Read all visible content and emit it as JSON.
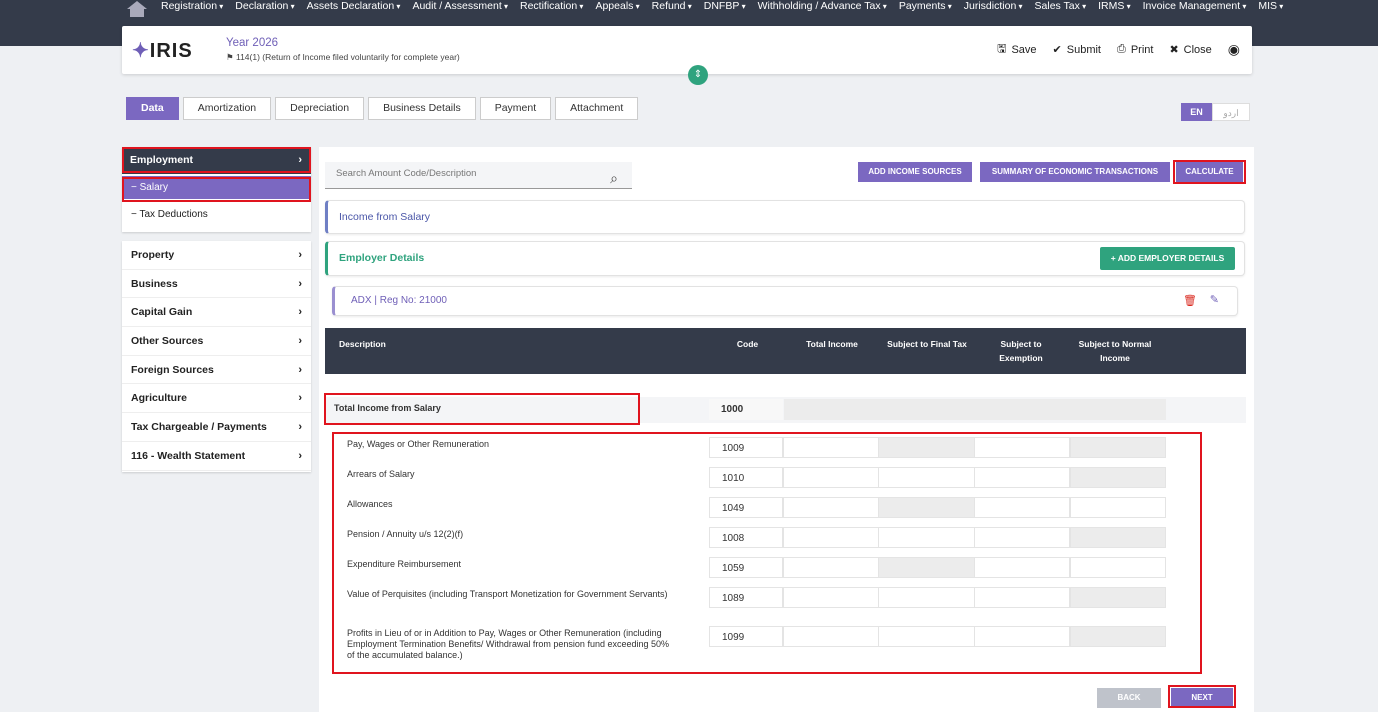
{
  "nav": {
    "items": [
      "Registration",
      "Declaration",
      "Assets Declaration",
      "Audit / Assessment",
      "Rectification",
      "Appeals",
      "Refund",
      "DNFBP",
      "Withholding / Advance Tax",
      "Payments",
      "Jurisdiction",
      "Sales Tax",
      "IRMS",
      "Invoice Management",
      "MIS"
    ]
  },
  "header": {
    "logo": "IRIS",
    "year": "Year 2026",
    "subtitle": "114(1) (Return of Income filed voluntarily for complete year)",
    "save": "Save",
    "submit": "Submit",
    "print": "Print",
    "close": "Close"
  },
  "tabs": [
    "Data",
    "Amortization",
    "Depreciation",
    "Business Details",
    "Payment",
    "Attachment"
  ],
  "lang": {
    "en": "EN",
    "ur": "اردو"
  },
  "sidebar": {
    "employment": "Employment",
    "salary": "− Salary",
    "tax_deductions": "− Tax Deductions",
    "items": [
      "Property",
      "Business",
      "Capital Gain",
      "Other Sources",
      "Foreign Sources",
      "Agriculture",
      "Tax Chargeable / Payments",
      "116 - Wealth Statement"
    ]
  },
  "search": {
    "placeholder": "Search Amount Code/Description"
  },
  "buttons": {
    "add_income": "ADD INCOME SOURCES",
    "summary": "SUMMARY OF ECONOMIC TRANSACTIONS",
    "calculate": "CALCULATE",
    "add_employer": "+ ADD EMPLOYER DETAILS",
    "back": "BACK",
    "next": "NEXT"
  },
  "sections": {
    "income_salary": "Income from Salary",
    "employer_details": "Employer Details",
    "employer": "ADX | Reg No: 21000"
  },
  "table": {
    "headers": [
      "Description",
      "Code",
      "Total Income",
      "Subject to Final Tax",
      "Subject to Exemption",
      "Subject to Normal Income"
    ],
    "total_label": "Total Income from Salary",
    "total_code": "1000",
    "rows": [
      {
        "desc": "Pay, Wages or Other Remuneration",
        "code": "1009"
      },
      {
        "desc": "Arrears of Salary",
        "code": "1010"
      },
      {
        "desc": "Allowances",
        "code": "1049"
      },
      {
        "desc": "Pension / Annuity u/s 12(2)(f)",
        "code": "1008"
      },
      {
        "desc": "Expenditure Reimbursement",
        "code": "1059"
      },
      {
        "desc": "Value of Perquisites (including Transport Monetization for Government Servants)",
        "code": "1089"
      },
      {
        "desc": "Profits in Lieu of or in Addition to Pay, Wages or Other Remuneration (including Employment Termination Benefits/ Withdrawal from pension fund exceeding 50% of the accumulated balance.)",
        "code": "1099"
      }
    ]
  },
  "colors": {
    "accent": "#7b68c1",
    "dark": "#343b4a",
    "green": "#2fa37e",
    "highlight": "#e0141e"
  }
}
